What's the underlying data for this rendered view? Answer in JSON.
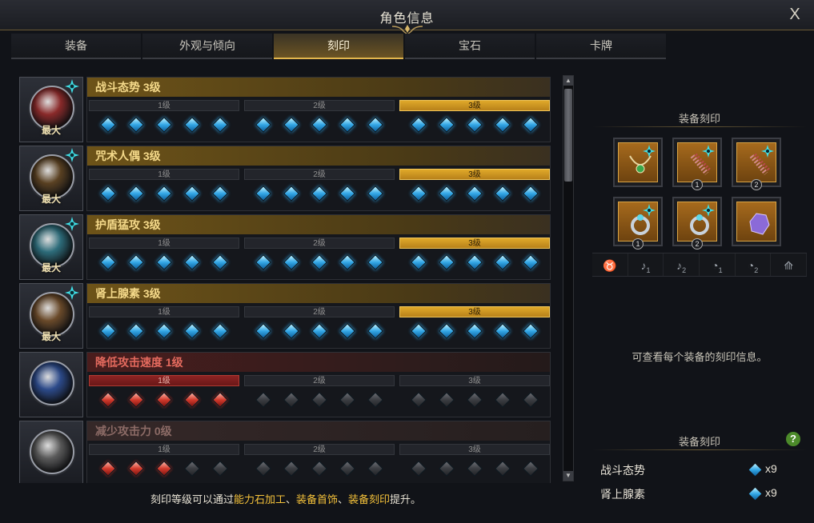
{
  "window": {
    "title": "角色信息",
    "close_label": "X"
  },
  "tabs": [
    {
      "label": "装备"
    },
    {
      "label": "外观与倾向"
    },
    {
      "label": "刻印",
      "active": true
    },
    {
      "label": "宝石"
    },
    {
      "label": "卡牌"
    }
  ],
  "engravings": [
    {
      "name": "战斗态势 3级",
      "max_label": "最大",
      "state": "gold",
      "levels": [
        "1级",
        "2级",
        "3级"
      ],
      "active_level": 3,
      "gems": [
        "blue",
        "blue",
        "blue",
        "blue",
        "blue",
        "blue",
        "blue",
        "blue",
        "blue",
        "blue",
        "blue",
        "blue",
        "blue",
        "blue",
        "blue"
      ],
      "orb_color": "#8a2a2a"
    },
    {
      "name": "咒术人偶 3级",
      "max_label": "最大",
      "state": "gold",
      "levels": [
        "1级",
        "2级",
        "3级"
      ],
      "active_level": 3,
      "gems": [
        "blue",
        "blue",
        "blue",
        "blue",
        "blue",
        "blue",
        "blue",
        "blue",
        "blue",
        "blue",
        "blue",
        "blue",
        "blue",
        "blue",
        "blue"
      ],
      "orb_color": "#5a4122"
    },
    {
      "name": "护盾猛攻 3级",
      "max_label": "最大",
      "state": "gold",
      "levels": [
        "1级",
        "2级",
        "3级"
      ],
      "active_level": 3,
      "gems": [
        "blue",
        "blue",
        "blue",
        "blue",
        "blue",
        "blue",
        "blue",
        "blue",
        "blue",
        "blue",
        "blue",
        "blue",
        "blue",
        "blue",
        "blue"
      ],
      "orb_color": "#2d6c7a"
    },
    {
      "name": "肾上腺素 3级",
      "max_label": "最大",
      "state": "gold",
      "levels": [
        "1级",
        "2级",
        "3级"
      ],
      "active_level": 3,
      "gems": [
        "blue",
        "blue",
        "blue",
        "blue",
        "blue",
        "blue",
        "blue",
        "blue",
        "blue",
        "blue",
        "blue",
        "blue",
        "blue",
        "blue",
        "blue"
      ],
      "orb_color": "#6a4a2a"
    },
    {
      "name": "降低攻击速度 1级",
      "max_label": "",
      "state": "red",
      "levels": [
        "1级",
        "2级",
        "3级"
      ],
      "active_level": 1,
      "gems": [
        "red",
        "red",
        "red",
        "red",
        "red",
        "gray",
        "gray",
        "gray",
        "gray",
        "gray",
        "gray",
        "gray",
        "gray",
        "gray",
        "gray"
      ],
      "orb_color": "#2c4a8a"
    },
    {
      "name": "减少攻击力 0级",
      "max_label": "",
      "state": "dim",
      "levels": [
        "1级",
        "2级",
        "3级"
      ],
      "active_level": 0,
      "gems": [
        "red",
        "red",
        "red",
        "gray",
        "gray",
        "gray",
        "gray",
        "gray",
        "gray",
        "gray",
        "gray",
        "gray",
        "gray",
        "gray",
        "gray"
      ],
      "orb_color": "#5a5a5a"
    }
  ],
  "footer": {
    "prefix": "刻印等级可以通过",
    "hl1": "能力石加工",
    "sep1": "、",
    "hl2": "装备首饰",
    "sep2": "、",
    "hl3": "装备刻印",
    "suffix": "提升。"
  },
  "right": {
    "equip_title": "装备刻印",
    "slots": [
      {
        "icon": "necklace-icon",
        "num": ""
      },
      {
        "icon": "earring-icon",
        "num": "1"
      },
      {
        "icon": "earring-icon",
        "num": "2"
      },
      {
        "icon": "ring-icon",
        "num": "1"
      },
      {
        "icon": "ring-icon",
        "num": "2"
      },
      {
        "icon": "ability-stone-icon",
        "num": ""
      }
    ],
    "categories": [
      {
        "glyph": "♉",
        "sub": ""
      },
      {
        "glyph": "♪",
        "sub": "1"
      },
      {
        "glyph": "♪",
        "sub": "2"
      },
      {
        "glyph": "◔",
        "sub": "1"
      },
      {
        "glyph": "◔",
        "sub": "2"
      },
      {
        "glyph": "⟰",
        "sub": ""
      }
    ],
    "hint": "可查看每个装备的刻印信息。",
    "summary_title": "装备刻印",
    "help_label": "?",
    "summary": [
      {
        "name": "战斗态势",
        "count": "x9"
      },
      {
        "name": "肾上腺素",
        "count": "x9"
      }
    ]
  }
}
